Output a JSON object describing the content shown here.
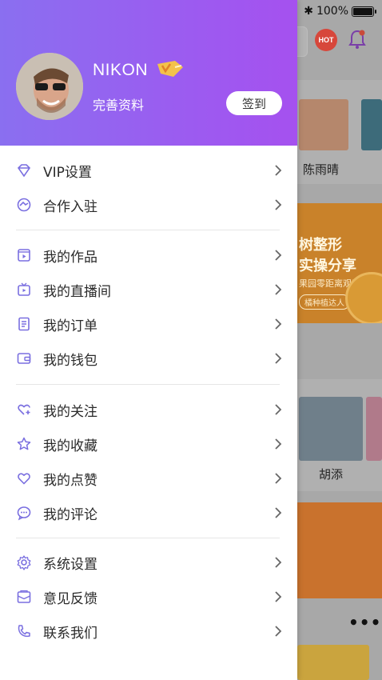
{
  "status_bar": {
    "battery_text": "100%",
    "battery_level": 1.0
  },
  "background": {
    "hot_badge": "HOT",
    "card_names": [
      "陈雨晴",
      "胡添"
    ],
    "banner_line1": "树整形",
    "banner_line2": "实操分享",
    "banner_line3": "果园零距离观摩",
    "banner_pill": "橘种植达人",
    "more_dots": "•••"
  },
  "drawer": {
    "username": "NIKON",
    "vip_badge_text": "V",
    "profile_link": "完善资料",
    "checkin_button": "签到",
    "menu_groups": [
      [
        {
          "label": "VIP设置",
          "icon": "diamond-icon"
        },
        {
          "label": "合作入驻",
          "icon": "handshake-icon"
        }
      ],
      [
        {
          "label": "我的作品",
          "icon": "film-icon"
        },
        {
          "label": "我的直播间",
          "icon": "tv-icon"
        },
        {
          "label": "我的订单",
          "icon": "document-icon"
        },
        {
          "label": "我的钱包",
          "icon": "wallet-icon"
        }
      ],
      [
        {
          "label": "我的关注",
          "icon": "heart-plus-icon"
        },
        {
          "label": "我的收藏",
          "icon": "star-icon"
        },
        {
          "label": "我的点赞",
          "icon": "heart-icon"
        },
        {
          "label": "我的评论",
          "icon": "comment-icon"
        }
      ],
      [
        {
          "label": "系统设置",
          "icon": "gear-icon"
        },
        {
          "label": "意见反馈",
          "icon": "mail-icon"
        },
        {
          "label": "联系我们",
          "icon": "phone-icon"
        }
      ]
    ]
  },
  "colors": {
    "accent": "#8b5cf0",
    "header_gradient_start": "#8a6ff0",
    "header_gradient_end": "#a551ef",
    "icon_stroke": "#7a6fe0"
  }
}
